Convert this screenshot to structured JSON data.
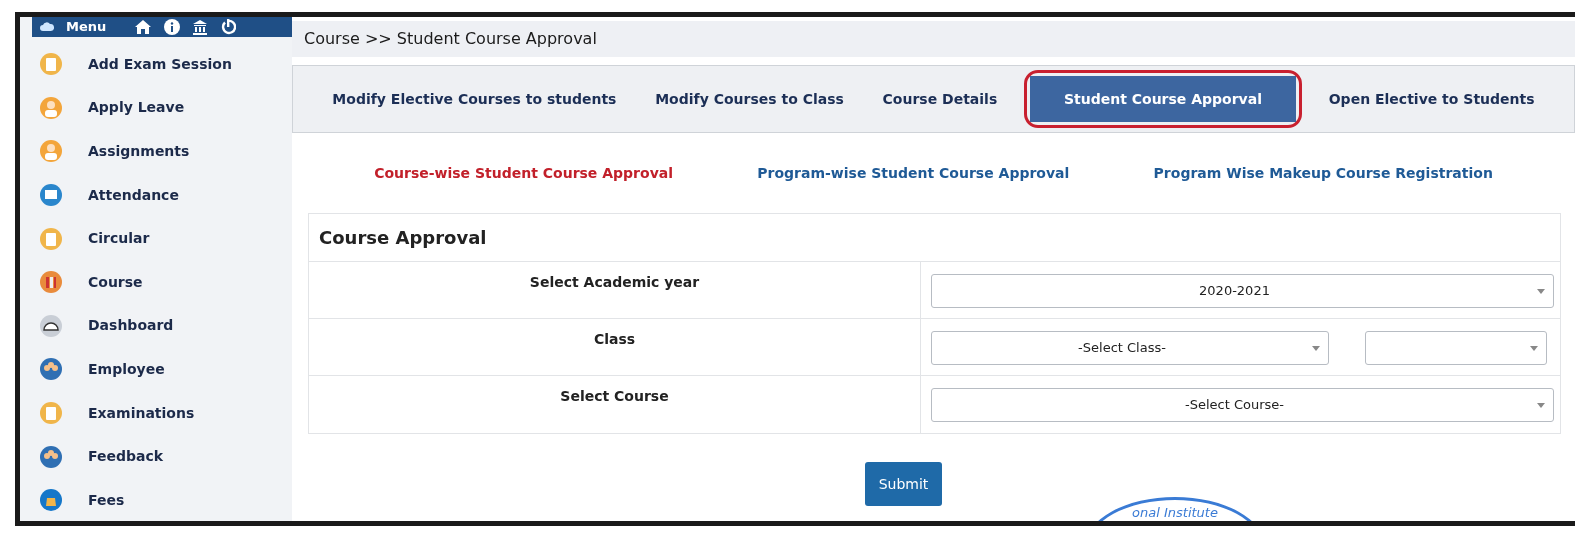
{
  "menu": {
    "title": "Menu"
  },
  "sidebar": {
    "items": [
      {
        "label": "Add Exam Session"
      },
      {
        "label": "Apply Leave"
      },
      {
        "label": "Assignments"
      },
      {
        "label": "Attendance"
      },
      {
        "label": "Circular"
      },
      {
        "label": "Course"
      },
      {
        "label": "Dashboard"
      },
      {
        "label": "Employee"
      },
      {
        "label": "Examinations"
      },
      {
        "label": "Feedback"
      },
      {
        "label": "Fees"
      }
    ]
  },
  "breadcrumb": "Course >> Student Course Approval",
  "tabs": [
    {
      "label": "Modify Elective Courses to students",
      "selected": false,
      "circled": false
    },
    {
      "label": "Modify Courses to Class",
      "selected": false,
      "circled": false
    },
    {
      "label": "Course Details",
      "selected": false,
      "circled": false
    },
    {
      "label": "Student Course Apporval",
      "selected": true,
      "circled": true
    },
    {
      "label": "Open Elective to Students",
      "selected": false,
      "circled": false
    }
  ],
  "sub_links": [
    {
      "label": "Course-wise Student Course Approval",
      "selected": true
    },
    {
      "label": "Program-wise Student Course Approval",
      "selected": false
    },
    {
      "label": "Program Wise Makeup Course Registration",
      "selected": false
    }
  ],
  "form": {
    "title": "Course Approval",
    "rows": [
      {
        "label": "Select Academic year",
        "selects": [
          {
            "kind": "filled",
            "value": "2020-2021"
          }
        ]
      },
      {
        "label": "Class",
        "selects": [
          {
            "kind": "filled",
            "value": "-Select Class-"
          },
          {
            "kind": "blank"
          }
        ]
      },
      {
        "label": "Select Course",
        "selects": [
          {
            "kind": "filled",
            "value": "-Select Course-"
          }
        ]
      }
    ],
    "submit": "Submit"
  },
  "stamp": {
    "text": "onal Institute"
  }
}
